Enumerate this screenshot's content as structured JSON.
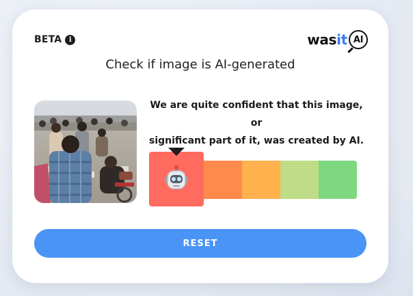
{
  "header": {
    "beta_label": "BETA",
    "info_icon": "i"
  },
  "logo": {
    "prefix": "was",
    "highlight": "it",
    "suffix": "AI",
    "highlight_color": "#3a7bf2"
  },
  "headline": "Check if image is AI-generated",
  "result": {
    "line1": "We are quite confident that this image, or",
    "line2": "significant part of it, was created by AI.",
    "meter": {
      "levels": 5,
      "active_level": 1,
      "colors": [
        "#ff6b5f",
        "#ff8a4c",
        "#ffb24d",
        "#bedd86",
        "#7ed87f"
      ],
      "icon": "robot-icon"
    }
  },
  "thumbnail": {
    "icon": "uploaded-photo"
  },
  "reset_label": "RESET",
  "colors": {
    "button": "#4a94f5",
    "card": "#ffffff"
  }
}
